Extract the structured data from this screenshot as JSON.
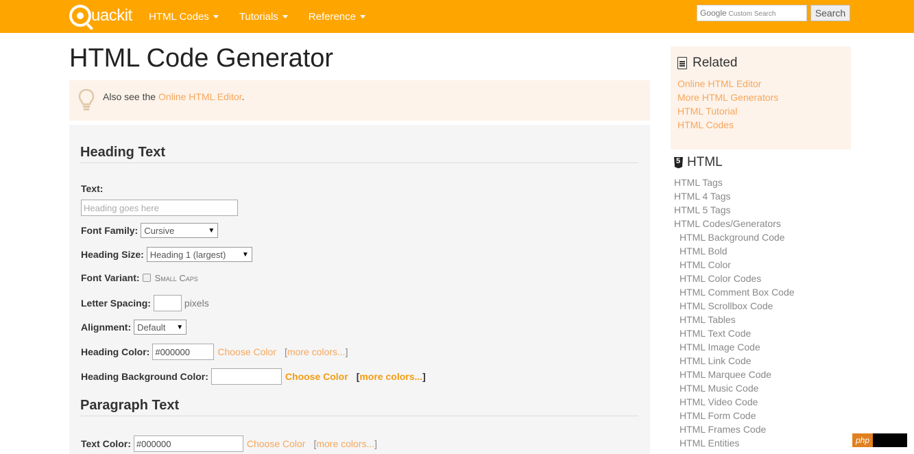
{
  "header": {
    "logo_text": "uackit",
    "nav": [
      {
        "label": "HTML Codes"
      },
      {
        "label": "Tutorials"
      },
      {
        "label": "Reference"
      }
    ],
    "search_brand": "Google",
    "search_placeholder": "Custom Search",
    "search_button": "Search"
  },
  "main": {
    "title": "HTML Code Generator",
    "note_prefix": "Also see the ",
    "note_link": "Online HTML Editor",
    "note_suffix": ".",
    "heading_section": {
      "title": "Heading Text",
      "text_label": "Text:",
      "text_placeholder": "Heading goes here",
      "font_family_label": "Font Family:",
      "font_family_value": "Cursive",
      "heading_size_label": "Heading Size:",
      "heading_size_value": "Heading 1 (largest)",
      "font_variant_label": "Font Variant:",
      "font_variant_option": "Small Caps",
      "letter_spacing_label": "Letter Spacing:",
      "letter_spacing_unit": "pixels",
      "alignment_label": "Alignment:",
      "alignment_value": "Default",
      "color_label": "Heading Color:",
      "color_value": "#000000",
      "choose_color": "Choose Color",
      "more_colors": "more colors...",
      "bg_color_label": "Heading Background Color:",
      "bg_choose_color": "Choose Color",
      "bg_more_colors": "more colors..."
    },
    "paragraph_section": {
      "title": "Paragraph Text",
      "text_color_label": "Text Color:",
      "text_color_value": "#000000",
      "choose_color": "Choose Color",
      "more_colors": "more colors..."
    }
  },
  "sidebar": {
    "related_title": "Related",
    "related_links": [
      "Online HTML Editor",
      "More HTML Generators",
      "HTML Tutorial",
      "HTML Codes"
    ],
    "html_title": "HTML",
    "html_links": [
      "HTML Tags",
      "HTML 4 Tags",
      "HTML 5 Tags",
      "HTML Codes/Generators"
    ],
    "html_sublinks": [
      "HTML Background Code",
      "HTML Bold",
      "HTML Color",
      "HTML Color Codes",
      "HTML Comment Box Code",
      "HTML Scrollbox Code",
      "HTML Tables",
      "HTML Text Code",
      "HTML Image Code",
      "HTML Link Code",
      "HTML Marquee Code",
      "HTML Music Code",
      "HTML Video Code",
      "HTML Form Code",
      "HTML Frames Code",
      "HTML Entities"
    ]
  },
  "badge": {
    "label": "php"
  },
  "colors": {
    "accent": "#ffa500",
    "link": "#f7a65b",
    "note_bg": "#fdf3ea",
    "panel_bg": "#f5f5f5"
  }
}
